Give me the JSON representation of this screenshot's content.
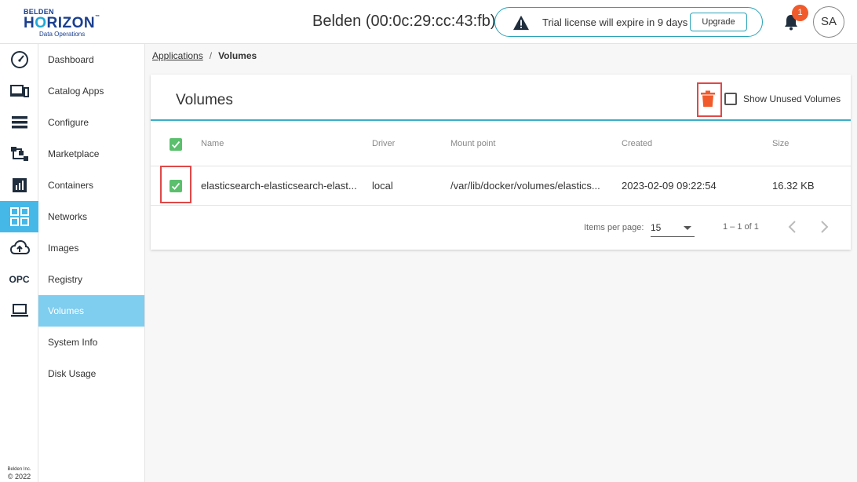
{
  "header": {
    "logo_line1": "BELDEN",
    "logo_line2_pre": "H",
    "logo_line2_o": "O",
    "logo_line2_post": "RIZON",
    "logo_tm": "™",
    "logo_line3": "Data Operations",
    "device_title": "Belden (00:0c:29:cc:43:fb)",
    "trial_message": "Trial license will expire in 9 days",
    "upgrade_label": "Upgrade",
    "notification_count": "1",
    "avatar_initials": "SA"
  },
  "rail": {
    "opc_label": "OPC",
    "footer_company": "Belden Inc.",
    "footer_year": "© 2022",
    "icons": [
      "speedometer-icon",
      "devices-icon",
      "list-icon",
      "hierarchy-icon",
      "chart-icon",
      "apps-grid-icon",
      "cloud-upload-icon",
      "opc-icon",
      "laptop-icon"
    ]
  },
  "menu": {
    "items": [
      {
        "label": "Dashboard"
      },
      {
        "label": "Catalog Apps"
      },
      {
        "label": "Configure"
      },
      {
        "label": "Marketplace"
      },
      {
        "label": "Containers"
      },
      {
        "label": "Networks"
      },
      {
        "label": "Images"
      },
      {
        "label": "Registry"
      },
      {
        "label": "Volumes"
      },
      {
        "label": "System Info"
      },
      {
        "label": "Disk Usage"
      }
    ],
    "active": "Volumes"
  },
  "breadcrumb": {
    "parent": "Applications",
    "separator": "/",
    "current": "Volumes"
  },
  "volumes": {
    "title": "Volumes",
    "show_unused_label": "Show Unused Volumes",
    "show_unused_checked": false,
    "columns": [
      "Name",
      "Driver",
      "Mount point",
      "Created",
      "Size"
    ],
    "rows": [
      {
        "checked": true,
        "name": "elasticsearch-elasticsearch-elast...",
        "driver": "local",
        "mount_point": "/var/lib/docker/volumes/elastics...",
        "created": "2023-02-09 09:22:54",
        "size": "16.32 KB"
      }
    ]
  },
  "pagination": {
    "items_per_page_label": "Items per page:",
    "items_per_page": "15",
    "range": "1 – 1 of 1"
  },
  "colors": {
    "accent": "#46b8e8",
    "teal": "#3aaec8",
    "checkbox_green": "#5bbf6e",
    "delete_orange": "#f15a2b",
    "highlight_red": "#e04848"
  }
}
